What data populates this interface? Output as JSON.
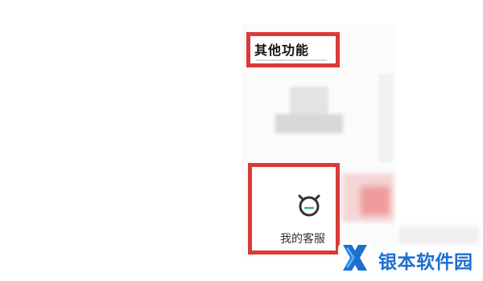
{
  "section": {
    "title": "其他功能"
  },
  "service_item": {
    "label": "我的客服",
    "icon": "customer-service-icon"
  },
  "watermark": {
    "text": "银本软件园",
    "icon": "watermark-logo-icon"
  },
  "colors": {
    "highlight": "#d93a3a",
    "watermark": "#1e6fcf"
  }
}
